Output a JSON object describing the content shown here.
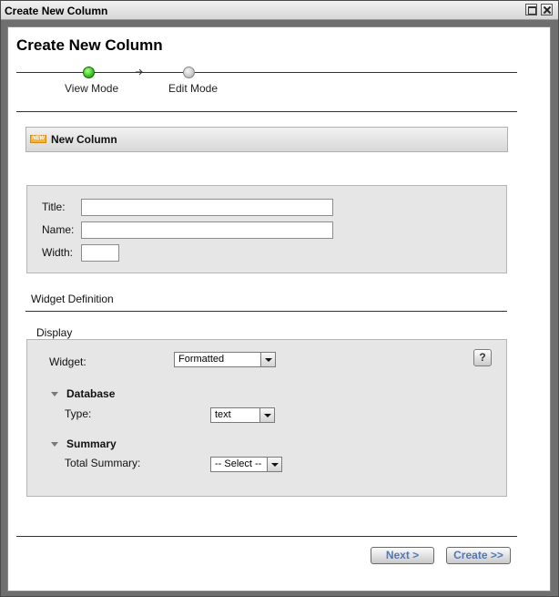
{
  "window": {
    "title": "Create New Column",
    "minimize_icon": "minimize-icon",
    "close_icon": "close-icon"
  },
  "page": {
    "title": "Create New Column"
  },
  "wizard": {
    "steps": [
      {
        "label": "View Mode",
        "state": "active",
        "color": "#31c41a"
      },
      {
        "label": "Edit Mode",
        "state": "inactive",
        "color": "#c9c9c9"
      }
    ]
  },
  "section": {
    "icon": "new-badge-icon",
    "icon_text": "NEW",
    "label": "New Column"
  },
  "fields": {
    "title": {
      "label": "Title:",
      "value": ""
    },
    "name": {
      "label": "Name:",
      "value": ""
    },
    "width": {
      "label": "Width:",
      "value": ""
    }
  },
  "widget_definition": {
    "label": "Widget Definition",
    "display_label": "Display",
    "widget": {
      "label": "Widget:",
      "selected": "Formatted"
    },
    "help_label": "?",
    "database": {
      "heading": "Database",
      "type": {
        "label": "Type:",
        "selected": "text"
      }
    },
    "summary": {
      "heading": "Summary",
      "total_summary": {
        "label": "Total Summary:",
        "selected": "-- Select --"
      }
    }
  },
  "footer": {
    "next_label": "Next >",
    "create_label": "Create >>"
  },
  "colors": {
    "button_text": "#4f77b7",
    "panel_bg": "#e6e6e6"
  }
}
